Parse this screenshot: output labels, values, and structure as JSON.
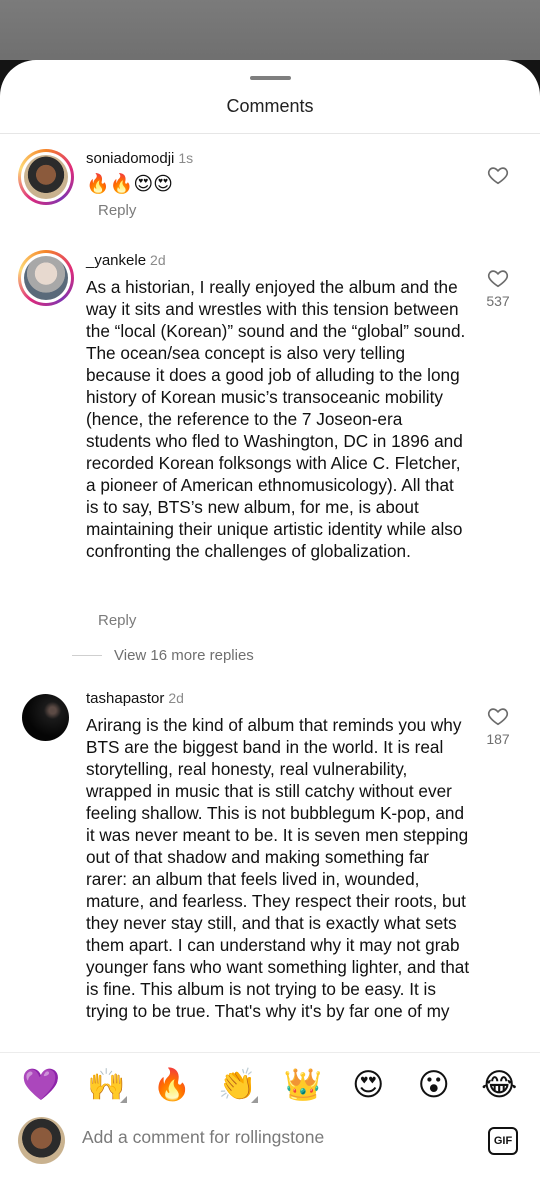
{
  "sheet": {
    "title": "Comments"
  },
  "comments": [
    {
      "username": "soniadomodji",
      "time": "1s",
      "text": "🔥🔥😍😍",
      "reply_label": "Reply",
      "likes": ""
    },
    {
      "username": "_yankele",
      "time": "2d",
      "text": "As a historian, I really enjoyed the album and the way it sits and wrestles with this tension between the “local (Korean)” sound and the “global” sound. The ocean/sea concept is also very telling because it does a good job of  alluding to the long history of Korean music’s transoceanic mobility (hence, the reference to the 7 Joseon-era students who fled to Washington, DC in 1896 and recorded Korean folksongs with Alice C. Fletcher, a pioneer of American ethnomusicology). All that is to say, BTS’s new album, for me, is about maintaining their unique artistic identity while also confronting the challenges of globalization.",
      "reply_label": "Reply",
      "likes": "537",
      "view_more": "View 16 more replies"
    },
    {
      "username": "tashapastor",
      "time": "2d",
      "text": "Arirang is the kind of album that reminds you why BTS are the biggest band in the world. It is real storytelling, real honesty, real vulnerability, wrapped in music that is still catchy without ever feeling shallow. This is not bubblegum K-pop, and it was never meant to be. It is seven men stepping out of that shadow and making something far rarer: an album that feels lived in, wounded, mature, and fearless. They respect their roots, but they never stay still, and that is exactly what sets them apart. I can understand why it may not grab younger fans who want something lighter, and that is fine. This album is not trying to be easy. It is trying to be true. That's why it's by far one of my",
      "likes": "187"
    }
  ],
  "quick_reactions": [
    "💜",
    "🙌",
    "🔥",
    "👏",
    "👑",
    "😍",
    "😮",
    "😂"
  ],
  "composer": {
    "placeholder": "Add a comment for rollingstone",
    "gif_label": "GIF"
  },
  "icons": {
    "like": "heart-outline-icon",
    "gif": "gif-icon"
  },
  "colors": {
    "sheet_bg": "#ffffff",
    "muted_text": "#7b7b7b",
    "story_ring": "#dd2a7b"
  }
}
